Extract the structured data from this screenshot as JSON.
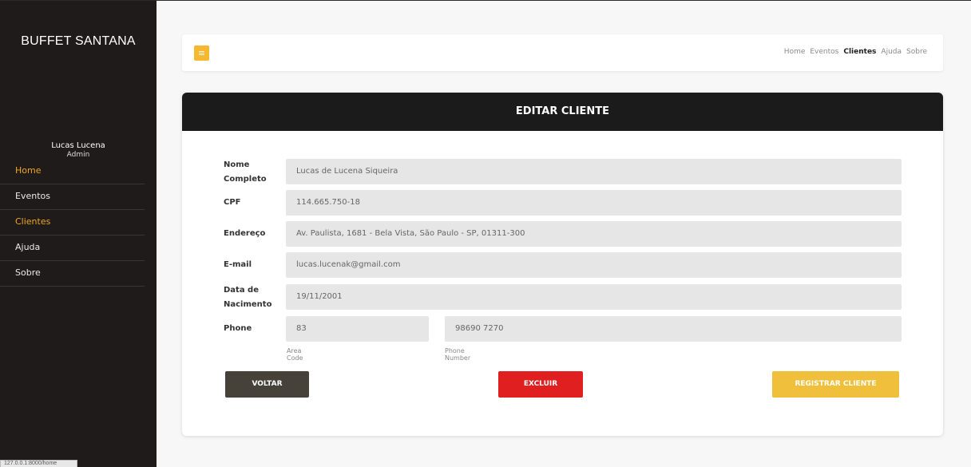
{
  "sidebar": {
    "brand": "BUFFET SANTANA",
    "user_name": "Lucas Lucena",
    "user_role": "Admin",
    "items": [
      {
        "label": "Home",
        "active": true
      },
      {
        "label": "Eventos",
        "active": false
      },
      {
        "label": "Clientes",
        "active": true
      },
      {
        "label": "Ajuda",
        "active": false
      },
      {
        "label": "Sobre",
        "active": false
      }
    ]
  },
  "status_url": "127.0.0.1:8000/home",
  "topbar": {
    "menu_icon": "hamburger-icon",
    "links": [
      "Home",
      "Eventos",
      "Clientes",
      "Ajuda",
      "Sobre"
    ]
  },
  "form": {
    "title": "EDITAR CLIENTE",
    "nome_label": "Nome Completo",
    "nome_value": "Lucas de Lucena Siqueira",
    "cpf_label": "CPF",
    "cpf_value": "114.665.750-18",
    "endereco_label": "Endereço",
    "endereco_value": "Av. Paulista, 1681 - Bela Vista, São Paulo - SP, 01311-300",
    "email_label": "E-mail",
    "email_value": "lucas.lucenak@gmail.com",
    "nascimento_label": "Data de Nacimento",
    "nascimento_value": "19/11/2001",
    "phone_label": "Phone",
    "area_code_value": "83",
    "area_code_hint": "Area Code",
    "phone_number_value": "98690 7270",
    "phone_number_hint": "Phone Number"
  },
  "buttons": {
    "back": "VOLTAR",
    "delete": "EXCLUIR",
    "submit": "REGISTRAR CLIENTE"
  },
  "colors": {
    "accent": "#f0a61f",
    "sidebar_bg": "#1f1b1b",
    "back_btn": "#474239",
    "delete_btn": "#e02020",
    "submit_btn": "#f0c03c"
  }
}
